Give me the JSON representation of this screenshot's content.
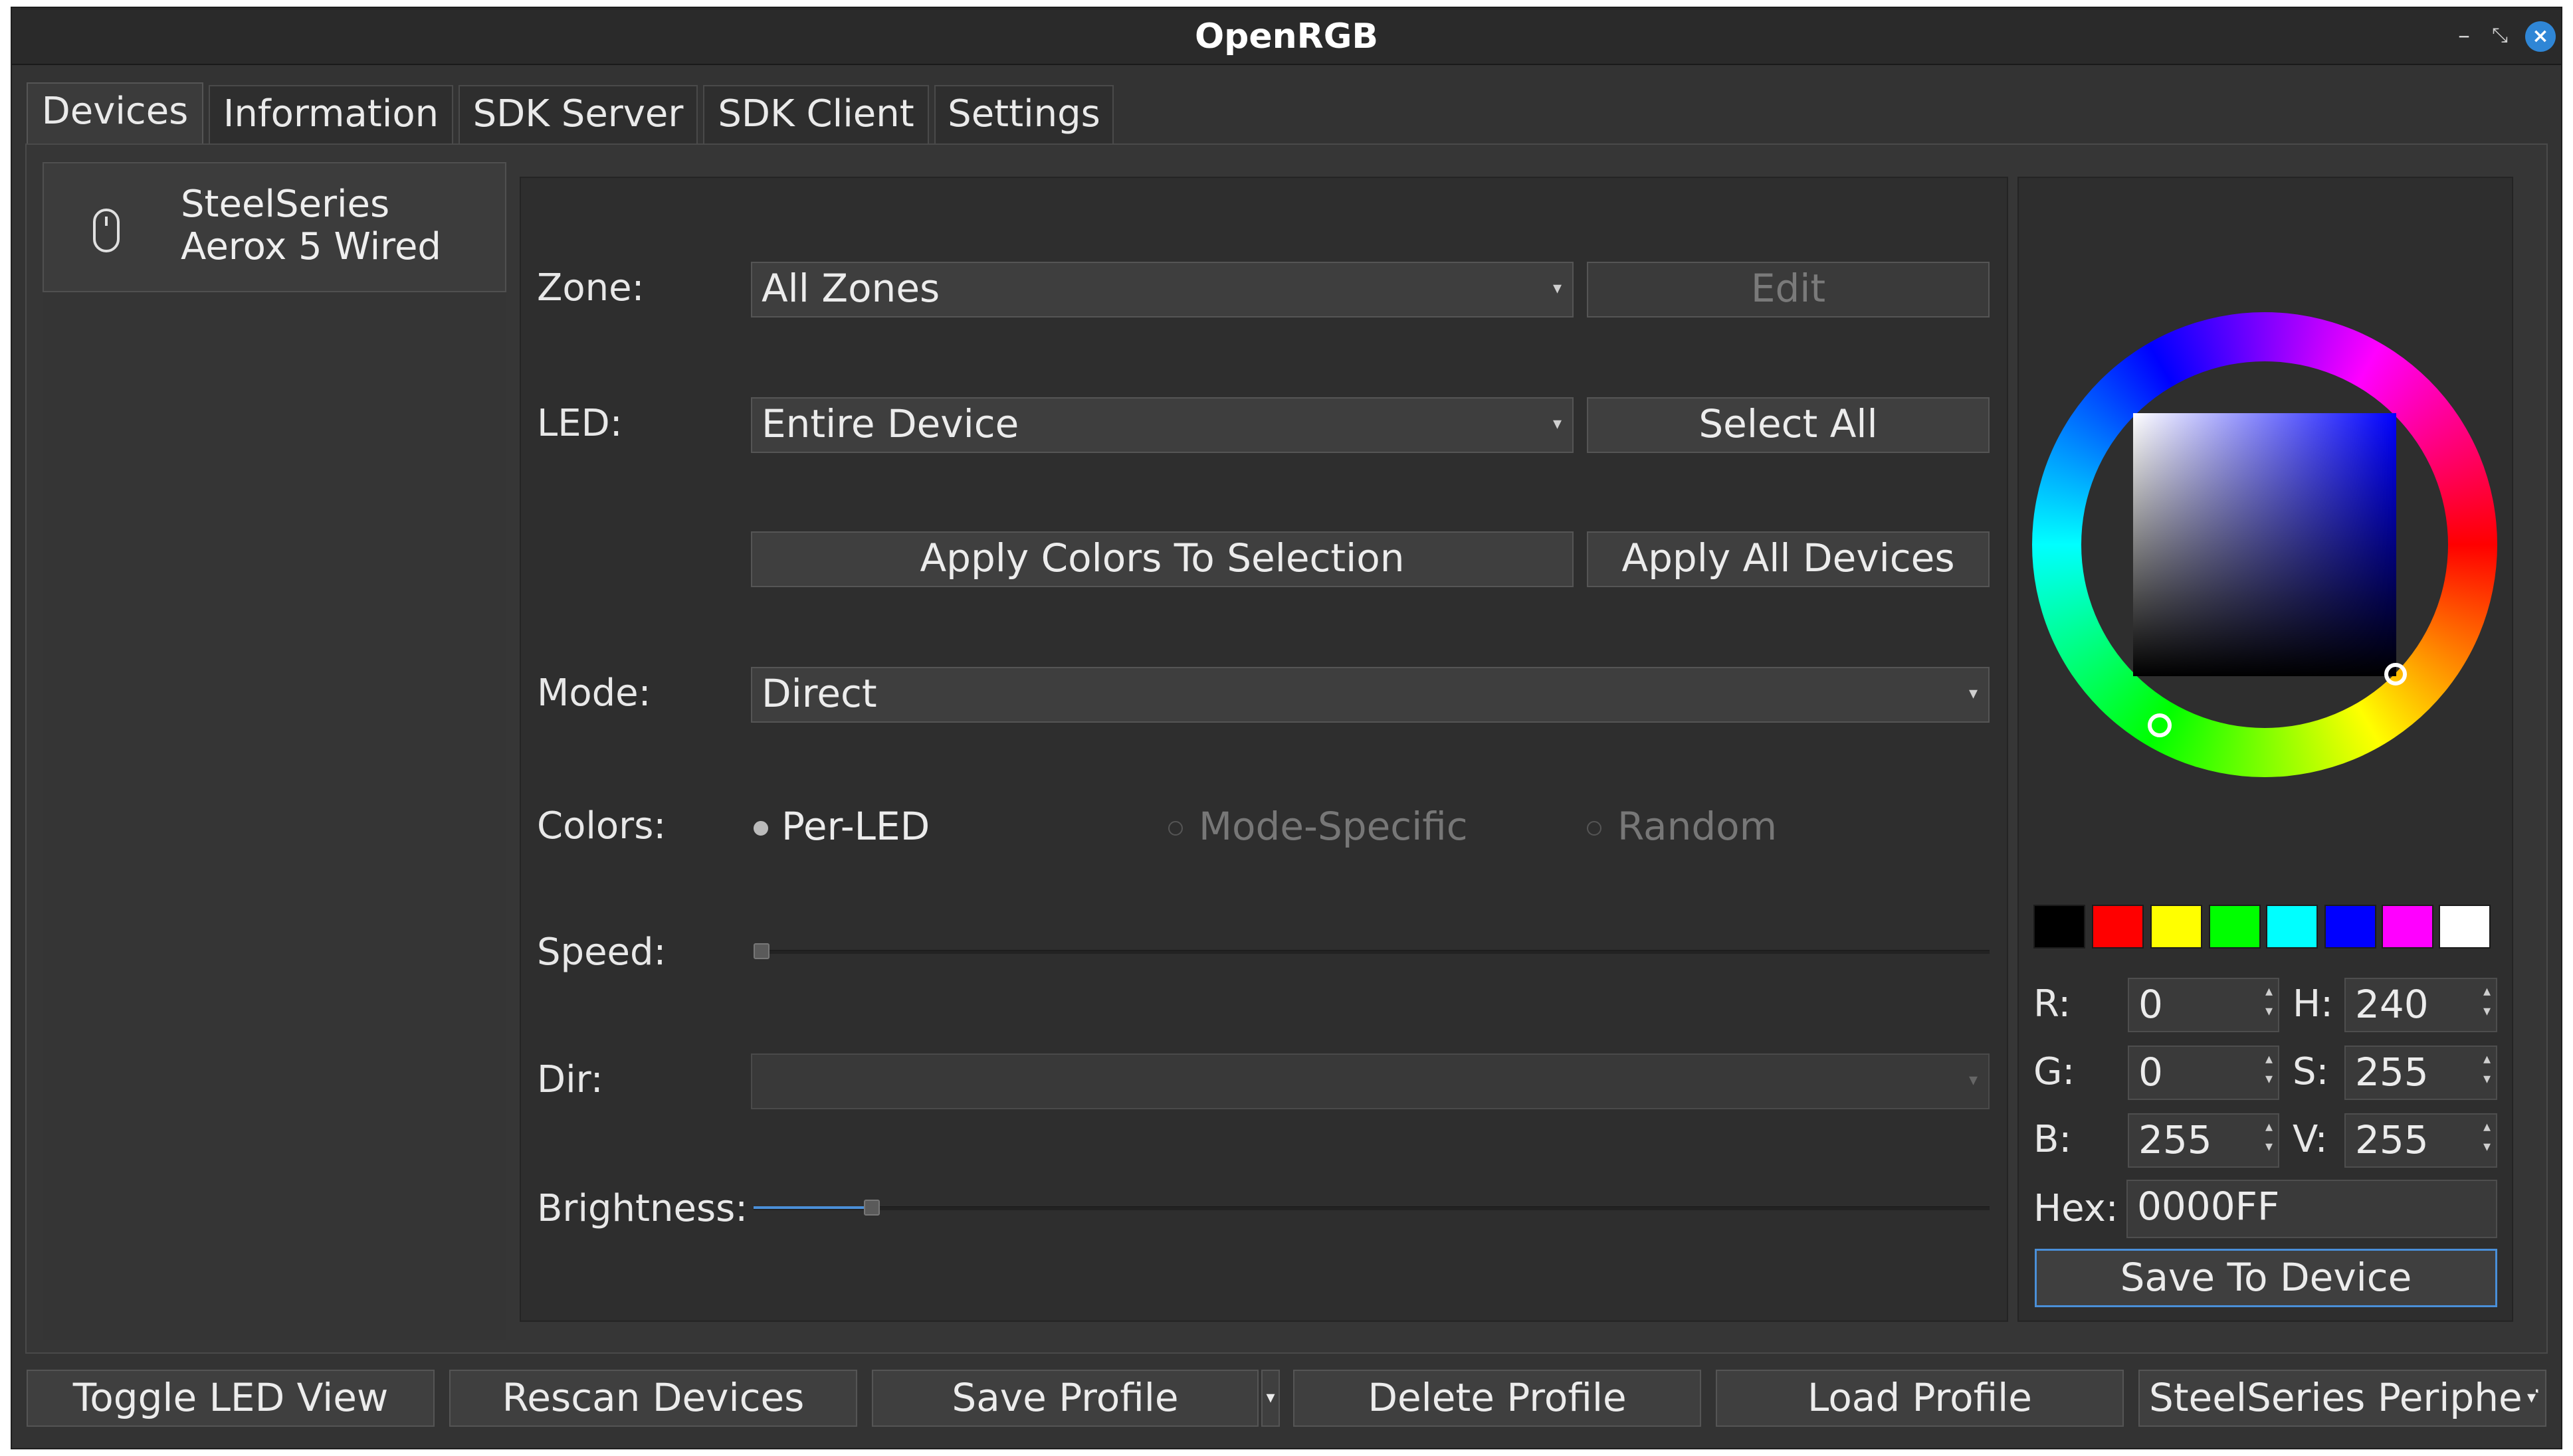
{
  "window": {
    "title": "OpenRGB",
    "controls": {
      "minimize": "–",
      "restore": "⤡",
      "close": "×"
    }
  },
  "tabs": [
    "Devices",
    "Information",
    "SDK Server",
    "SDK Client",
    "Settings"
  ],
  "active_tab": "Devices",
  "device_list": [
    {
      "name_line1": "SteelSeries",
      "name_line2": "Aerox 5 Wired",
      "icon": "mouse-icon"
    }
  ],
  "controls": {
    "zone_label": "Zone:",
    "zone_value": "All Zones",
    "edit_button": "Edit",
    "led_label": "LED:",
    "led_value": "Entire Device",
    "select_all_button": "Select All",
    "apply_selection_button": "Apply Colors To Selection",
    "apply_all_button": "Apply All Devices",
    "mode_label": "Mode:",
    "mode_value": "Direct",
    "colors_label": "Colors:",
    "color_modes": [
      {
        "label": "Per-LED",
        "selected": true,
        "enabled": true
      },
      {
        "label": "Mode-Specific",
        "selected": false,
        "enabled": false
      },
      {
        "label": "Random",
        "selected": false,
        "enabled": false
      }
    ],
    "speed_label": "Speed:",
    "speed_level": 0,
    "dir_label": "Dir:",
    "dir_value": "",
    "brightness_label": "Brightness:",
    "brightness_level": 0.1
  },
  "color_picker": {
    "swatches": [
      "#000000",
      "#ff0000",
      "#ffff00",
      "#00ff00",
      "#00ffff",
      "#0000ff",
      "#ff00ff",
      "#ffffff"
    ],
    "r_label": "R:",
    "r": "0",
    "g_label": "G:",
    "g": "0",
    "b_label": "B:",
    "b": "255",
    "h_label": "H:",
    "h": "240",
    "s_label": "S:",
    "s": "255",
    "v_label": "V:",
    "v": "255",
    "hex_label": "Hex:",
    "hex": "0000FF",
    "save_button": "Save To Device"
  },
  "bottom_bar": {
    "toggle_led_view": "Toggle LED View",
    "rescan_devices": "Rescan Devices",
    "save_profile": "Save Profile",
    "delete_profile": "Delete Profile",
    "load_profile": "Load Profile",
    "profile_select": "SteelSeries Peripher"
  },
  "colors": {
    "accent": "#4a8fd8",
    "close_button": "#2f86d6"
  }
}
